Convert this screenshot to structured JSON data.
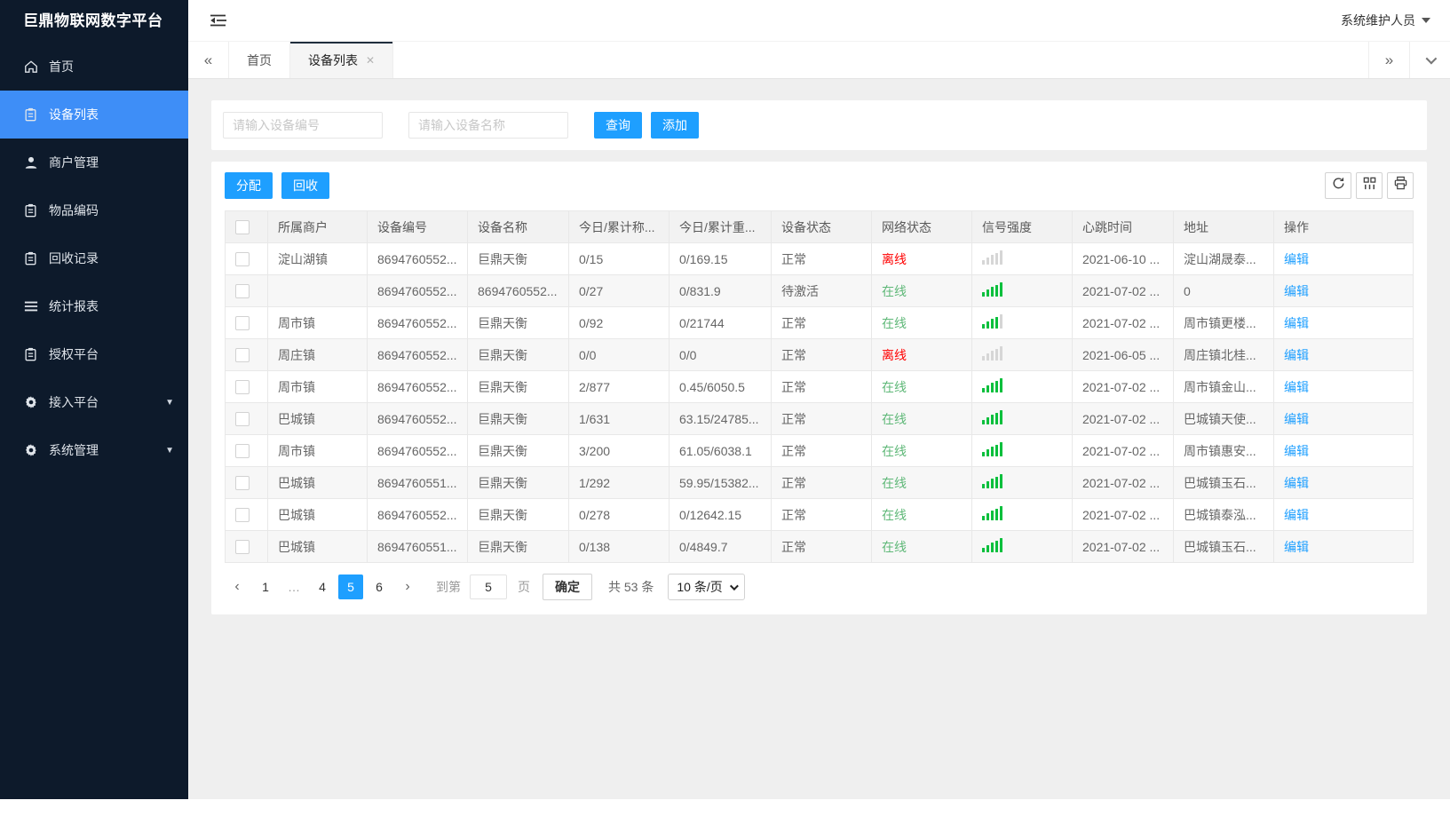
{
  "colors": {
    "accent": "#1E9FFF",
    "sidebar_bg": "#0d1a2b",
    "sidebar_active": "#3E8EF7",
    "online": "#5FB878",
    "offline": "#FF0000",
    "signal_on": "#0abf3c",
    "signal_off": "#d6d6d6"
  },
  "app": {
    "title": "巨鼎物联网数字平台",
    "user": "系统维护人员"
  },
  "sidebar": {
    "items": [
      {
        "name": "home",
        "label": "首页",
        "icon": "home-icon",
        "active": false,
        "expandable": false
      },
      {
        "name": "device-list",
        "label": "设备列表",
        "icon": "doc-icon",
        "active": true,
        "expandable": false
      },
      {
        "name": "merchant-management",
        "label": "商户管理",
        "icon": "user-icon",
        "active": false,
        "expandable": false
      },
      {
        "name": "item-code",
        "label": "物品编码",
        "icon": "doc-icon",
        "active": false,
        "expandable": false
      },
      {
        "name": "recycle-records",
        "label": "回收记录",
        "icon": "doc-icon",
        "active": false,
        "expandable": false
      },
      {
        "name": "statistics-report",
        "label": "统计报表",
        "icon": "stats-icon",
        "active": false,
        "expandable": false
      },
      {
        "name": "auth-platform",
        "label": "授权平台",
        "icon": "doc-icon",
        "active": false,
        "expandable": false
      },
      {
        "name": "access-platform",
        "label": "接入平台",
        "icon": "gear-icon",
        "active": false,
        "expandable": true
      },
      {
        "name": "system-management",
        "label": "系统管理",
        "icon": "gear-icon",
        "active": false,
        "expandable": true
      }
    ]
  },
  "tabs": {
    "items": [
      {
        "name": "home",
        "label": "首页",
        "active": false,
        "closable": false
      },
      {
        "name": "device-list",
        "label": "设备列表",
        "active": true,
        "closable": true
      }
    ]
  },
  "search": {
    "device_no_placeholder": "请输入设备编号",
    "device_name_placeholder": "请输入设备名称",
    "query_label": "查询",
    "add_label": "添加"
  },
  "toolbar": {
    "assign_label": "分配",
    "recycle_label": "回收",
    "icons": [
      {
        "name": "refresh-icon"
      },
      {
        "name": "columns-filter-icon"
      },
      {
        "name": "print-icon"
      }
    ]
  },
  "table": {
    "columns": [
      "所属商户",
      "设备编号",
      "设备名称",
      "今日/累计称...",
      "今日/累计重...",
      "设备状态",
      "网络状态",
      "信号强度",
      "心跳时间",
      "地址",
      "操作"
    ],
    "rows": [
      {
        "merchant": "淀山湖镇",
        "device_no": "8694760552...",
        "device_name": "巨鼎天衡",
        "today_count": "0/15",
        "today_weight": "0/169.15",
        "device_status": "正常",
        "network_status": "离线",
        "online": false,
        "signal": 0,
        "heartbeat": "2021-06-10 ...",
        "address": "淀山湖晟泰...",
        "action": "编辑"
      },
      {
        "merchant": "",
        "device_no": "8694760552...",
        "device_name": "8694760552...",
        "today_count": "0/27",
        "today_weight": "0/831.9",
        "device_status": "待激活",
        "network_status": "在线",
        "online": true,
        "signal": 5,
        "heartbeat": "2021-07-02 ...",
        "address": "0",
        "action": "编辑"
      },
      {
        "merchant": "周市镇",
        "device_no": "8694760552...",
        "device_name": "巨鼎天衡",
        "today_count": "0/92",
        "today_weight": "0/21744",
        "device_status": "正常",
        "network_status": "在线",
        "online": true,
        "signal": 4,
        "heartbeat": "2021-07-02 ...",
        "address": "周市镇更楼...",
        "action": "编辑"
      },
      {
        "merchant": "周庄镇",
        "device_no": "8694760552...",
        "device_name": "巨鼎天衡",
        "today_count": "0/0",
        "today_weight": "0/0",
        "device_status": "正常",
        "network_status": "离线",
        "online": false,
        "signal": 0,
        "heartbeat": "2021-06-05 ...",
        "address": "周庄镇北桂...",
        "action": "编辑"
      },
      {
        "merchant": "周市镇",
        "device_no": "8694760552...",
        "device_name": "巨鼎天衡",
        "today_count": "2/877",
        "today_weight": "0.45/6050.5",
        "device_status": "正常",
        "network_status": "在线",
        "online": true,
        "signal": 5,
        "heartbeat": "2021-07-02 ...",
        "address": "周市镇金山...",
        "action": "编辑"
      },
      {
        "merchant": "巴城镇",
        "device_no": "8694760552...",
        "device_name": "巨鼎天衡",
        "today_count": "1/631",
        "today_weight": "63.15/24785...",
        "device_status": "正常",
        "network_status": "在线",
        "online": true,
        "signal": 5,
        "heartbeat": "2021-07-02 ...",
        "address": "巴城镇天使...",
        "action": "编辑"
      },
      {
        "merchant": "周市镇",
        "device_no": "8694760552...",
        "device_name": "巨鼎天衡",
        "today_count": "3/200",
        "today_weight": "61.05/6038.1",
        "device_status": "正常",
        "network_status": "在线",
        "online": true,
        "signal": 5,
        "heartbeat": "2021-07-02 ...",
        "address": "周市镇惠安...",
        "action": "编辑"
      },
      {
        "merchant": "巴城镇",
        "device_no": "8694760551...",
        "device_name": "巨鼎天衡",
        "today_count": "1/292",
        "today_weight": "59.95/15382...",
        "device_status": "正常",
        "network_status": "在线",
        "online": true,
        "signal": 5,
        "heartbeat": "2021-07-02 ...",
        "address": "巴城镇玉石...",
        "action": "编辑"
      },
      {
        "merchant": "巴城镇",
        "device_no": "8694760552...",
        "device_name": "巨鼎天衡",
        "today_count": "0/278",
        "today_weight": "0/12642.15",
        "device_status": "正常",
        "network_status": "在线",
        "online": true,
        "signal": 5,
        "heartbeat": "2021-07-02 ...",
        "address": "巴城镇泰泓...",
        "action": "编辑"
      },
      {
        "merchant": "巴城镇",
        "device_no": "8694760551...",
        "device_name": "巨鼎天衡",
        "today_count": "0/138",
        "today_weight": "0/4849.7",
        "device_status": "正常",
        "network_status": "在线",
        "online": true,
        "signal": 5,
        "heartbeat": "2021-07-02 ...",
        "address": "巴城镇玉石...",
        "action": "编辑"
      }
    ]
  },
  "pagination": {
    "prev_label": "‹",
    "next_label": "›",
    "pages": [
      "1",
      "…",
      "4",
      "5",
      "6"
    ],
    "active_page": "5",
    "goto_label": "到第",
    "goto_value": "5",
    "page_label": "页",
    "confirm_label": "确定",
    "total_label": "共 53 条",
    "page_size": "10 条/页"
  }
}
